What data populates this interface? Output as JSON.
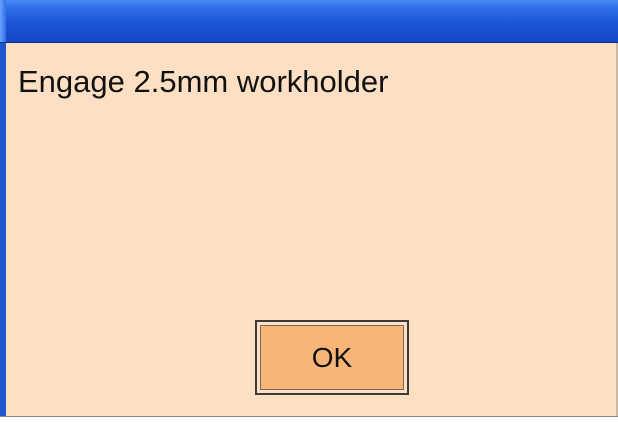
{
  "dialog": {
    "title": "",
    "message": "Engage 2.5mm workholder",
    "ok_label": "OK"
  },
  "colors": {
    "titlebar": "#1a55d8",
    "background": "#fde0c4",
    "button": "#f9b478"
  }
}
